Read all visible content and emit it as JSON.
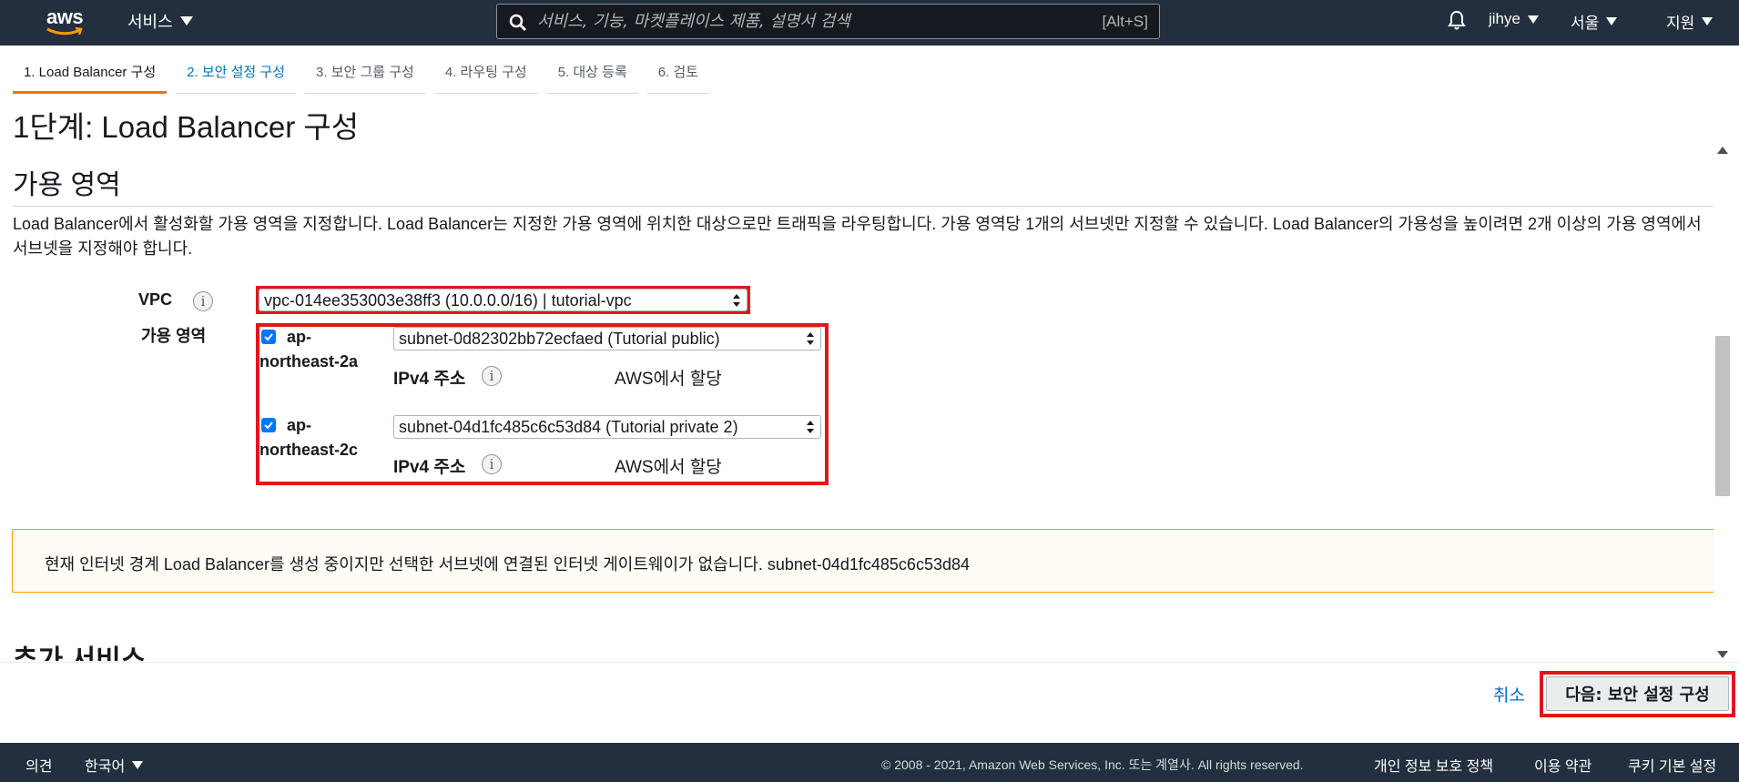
{
  "topnav": {
    "logo_text": "aws",
    "services_label": "서비스",
    "search_placeholder": "서비스, 기능, 마켓플레이스 제품, 설명서 검색",
    "search_shortcut": "[Alt+S]",
    "user_label": "jihye",
    "region_label": "서울",
    "support_label": "지원"
  },
  "steps": [
    {
      "label": "1. Load Balancer 구성"
    },
    {
      "label": "2. 보안 설정 구성"
    },
    {
      "label": "3. 보안 그룹 구성"
    },
    {
      "label": "4. 라우팅 구성"
    },
    {
      "label": "5. 대상 등록"
    },
    {
      "label": "6. 검토"
    }
  ],
  "page_title": "1단계: Load Balancer 구성",
  "az_section": {
    "title": "가용 영역",
    "description": "Load Balancer에서 활성화할 가용 영역을 지정합니다. Load Balancer는 지정한 가용 영역에 위치한 대상으로만 트래픽을 라우팅합니다. 가용 영역당 1개의 서브넷만 지정할 수 있습니다. Load Balancer의 가용성을 높이려면 2개 이상의 가용 영역에서 서브넷을 지정해야 합니다.",
    "vpc_label": "VPC",
    "vpc_value": "vpc-014ee353003e38ff3 (10.0.0.0/16) | tutorial-vpc",
    "az_label": "가용 영역",
    "zones": [
      {
        "name_line1": "ap-",
        "name_line2": "northeast-2a",
        "subnet": "subnet-0d82302bb72ecfaed (Tutorial public)",
        "ipv4_label": "IPv4 주소",
        "ipv4_value": "AWS에서 할당"
      },
      {
        "name_line1": "ap-",
        "name_line2": "northeast-2c",
        "subnet": "subnet-04d1fc485c6c53d84 (Tutorial private 2)",
        "ipv4_label": "IPv4 주소",
        "ipv4_value": "AWS에서 할당"
      }
    ],
    "warning": "현재 인터넷 경계 Load Balancer를 생성 중이지만 선택한 서브넷에 연결된 인터넷 게이트웨이가 없습니다. subnet-04d1fc485c6c53d84"
  },
  "next_section_title": "추가 서비스",
  "actions": {
    "cancel_label": "취소",
    "next_label": "다음: 보안 설정 구성"
  },
  "footer": {
    "feedback": "의견",
    "language": "한국어",
    "copyright": "© 2008 - 2021, Amazon Web Services, Inc. 또는 계열사. All rights reserved.",
    "privacy": "개인 정보 보호 정책",
    "terms": "이용 약관",
    "cookies": "쿠키 기본 설정"
  },
  "colors": {
    "nav_bg": "#232f3e",
    "accent_orange": "#ec7211",
    "link_blue": "#0073bb",
    "highlight_red": "#e4141c",
    "warning_border": "#ff9900"
  },
  "icons": [
    "aws-logo",
    "search-icon",
    "bell-icon",
    "info-icon",
    "checkbox-checked-icon",
    "select-arrows-icon",
    "chevron-down-icon"
  ]
}
